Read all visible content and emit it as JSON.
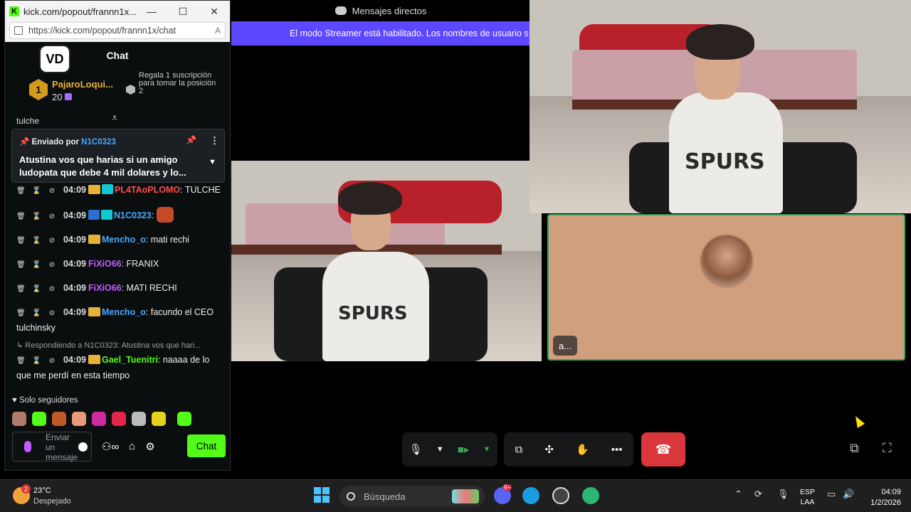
{
  "kick_window": {
    "title": "kick.com/popout/frannn1x...",
    "url": "https://kick.com/popout/frannn1x/chat",
    "reader_label": "A",
    "chat_title": "Chat",
    "logo_text": "VD",
    "leader": {
      "rank": "1",
      "name": "PajaroLoqui...",
      "count": "20",
      "gift_text": "Regala 1 suscripción para tomar la posición 2"
    },
    "cut_line": "tulche",
    "pinned": {
      "prefix": "Enviado por",
      "user": "N1C0323",
      "message": "Atustina vos que harias si un amigo ludopata que debe 4 mil dolares y lo..."
    },
    "messages": [
      {
        "time": "04:09",
        "user": "PL4TAoPLOMO",
        "color": "#ff4d4d",
        "badge": "crown2",
        "text": "TULCHE"
      },
      {
        "time": "04:09",
        "user": "N1C0323",
        "color": "#4aa7ff",
        "badge": "blue",
        "text": "",
        "emote": true
      },
      {
        "time": "04:09",
        "user": "Mencho_o",
        "color": "#4aa7ff",
        "badge": "crown",
        "text": "mati rechi"
      },
      {
        "time": "04:09",
        "user": "FiXiO66",
        "color": "#c05cff",
        "badge": "",
        "text": "FRANIX"
      },
      {
        "time": "04:09",
        "user": "FiXiO66",
        "color": "#c05cff",
        "badge": "",
        "text": "MATI RECHI"
      },
      {
        "time": "04:09",
        "user": "Mencho_o",
        "color": "#4aa7ff",
        "badge": "crown",
        "text": "facundo el CEO tulchinsky"
      }
    ],
    "reply": {
      "label": "Respondiendo a N1C0323: Atustina vos que hari...",
      "time": "04:09",
      "user": "Gael_Tuenitri",
      "color": "#53fc18",
      "text": "naaaa de lo que me perdí en esta tiempo"
    },
    "followers_only": "Solo seguidores",
    "input_placeholder": "Enviar un mensaje",
    "chat_button": "Chat"
  },
  "discord": {
    "title": "Mensajes directos",
    "banner": "El modo Streamer está habilitado. Los nombres de usuario s",
    "tile_name": "a...",
    "icons": {
      "mic": "mic-icon",
      "camera": "camera-icon",
      "share": "screen-share-icon",
      "activities": "activities-icon",
      "soundboard": "soundboard-icon",
      "more": "more-icon",
      "end": "end-call-icon"
    }
  },
  "taskbar": {
    "weather_badge": "2",
    "temp": "23°C",
    "condition": "Despejado",
    "search": "Búsqueda",
    "discord_badge": "9+",
    "lang1": "ESP",
    "lang2": "LAA",
    "time": "04:09",
    "date": "1/2/2026"
  }
}
